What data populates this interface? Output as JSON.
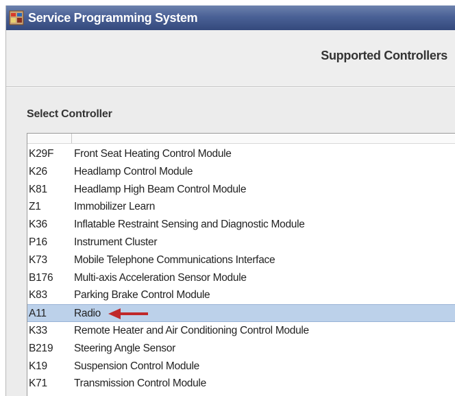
{
  "window": {
    "title": "Service Programming System",
    "icon": "sps-app-icon"
  },
  "header": {
    "section_title": "Supported Controllers"
  },
  "selector": {
    "label": "Select Controller"
  },
  "controllers": [
    {
      "code": "K29F",
      "name": "Front Seat Heating Control Module",
      "selected": false
    },
    {
      "code": "K26",
      "name": "Headlamp Control Module",
      "selected": false
    },
    {
      "code": "K81",
      "name": "Headlamp High Beam Control Module",
      "selected": false
    },
    {
      "code": "Z1",
      "name": "Immobilizer Learn",
      "selected": false
    },
    {
      "code": "K36",
      "name": "Inflatable Restraint Sensing and Diagnostic Module",
      "selected": false
    },
    {
      "code": "P16",
      "name": "Instrument Cluster",
      "selected": false
    },
    {
      "code": "K73",
      "name": "Mobile Telephone Communications Interface",
      "selected": false
    },
    {
      "code": "B176",
      "name": "Multi-axis Acceleration Sensor Module",
      "selected": false
    },
    {
      "code": "K83",
      "name": "Parking Brake Control Module",
      "selected": false
    },
    {
      "code": "A11",
      "name": "Radio",
      "selected": true
    },
    {
      "code": "K33",
      "name": "Remote Heater and Air Conditioning Control Module",
      "selected": false
    },
    {
      "code": "B219",
      "name": "Steering Angle Sensor",
      "selected": false
    },
    {
      "code": "K19",
      "name": "Suspension Control Module",
      "selected": false
    },
    {
      "code": "K71",
      "name": "Transmission Control Module",
      "selected": false
    }
  ],
  "annotation": {
    "icon": "red-arrow-icon",
    "color": "#c0282a"
  },
  "colors": {
    "titlebar": "#4a6196",
    "selection": "#bcd1ea",
    "panel": "#ececec"
  }
}
